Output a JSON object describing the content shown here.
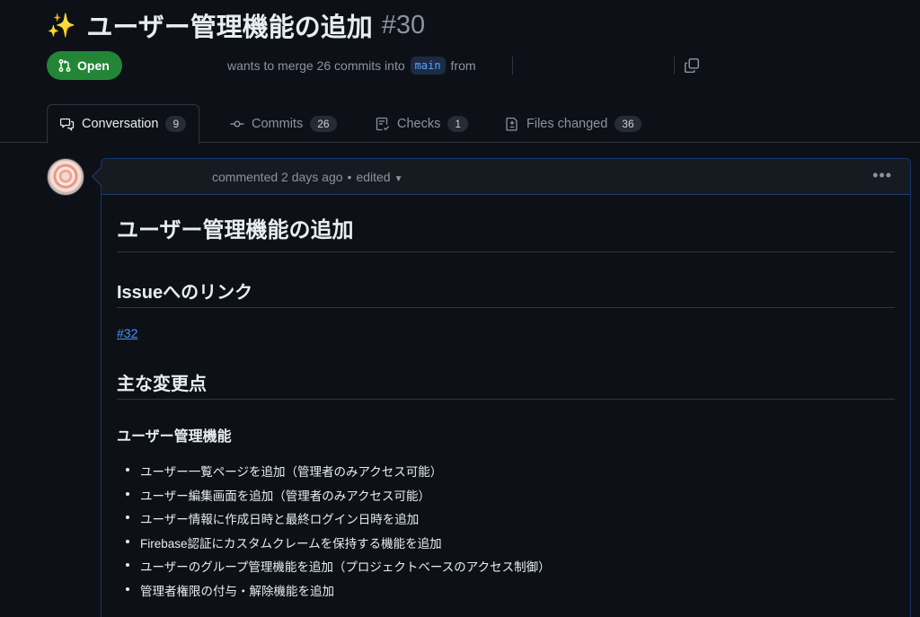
{
  "pr": {
    "emoji": "✨",
    "title": "ユーザー管理機能の追加",
    "number": "#30",
    "state": "Open",
    "merge_text_1": "wants to merge 26 commits into",
    "base_branch": "main",
    "merge_text_2": "from"
  },
  "tabs": [
    {
      "label": "Conversation",
      "count": "9",
      "icon": "comment-discussion-icon"
    },
    {
      "label": "Commits",
      "count": "26",
      "icon": "git-commit-icon"
    },
    {
      "label": "Checks",
      "count": "1",
      "icon": "checklist-icon"
    },
    {
      "label": "Files changed",
      "count": "36",
      "icon": "file-diff-icon"
    }
  ],
  "comment": {
    "meta": "commented 2 days ago",
    "separator": "•",
    "edited": "edited",
    "heading": "ユーザー管理機能の追加",
    "issue_section_title": "Issueへのリンク",
    "issue_link": "#32",
    "changes_title": "主な変更点",
    "subsection_title": "ユーザー管理機能",
    "items": [
      "ユーザー一覧ページを追加（管理者のみアクセス可能）",
      "ユーザー編集画面を追加（管理者のみアクセス可能）",
      "ユーザー情報に作成日時と最終ログイン日時を追加",
      "Firebase認証にカスタムクレームを保持する機能を追加",
      "ユーザーのグループ管理機能を追加（プロジェクトベースのアクセス制御）",
      "管理者権限の付与・解除機能を追加"
    ]
  },
  "colors": {
    "background": "#0d1117",
    "open_badge": "#238636",
    "link": "#4493f8",
    "muted": "#8b949e"
  }
}
